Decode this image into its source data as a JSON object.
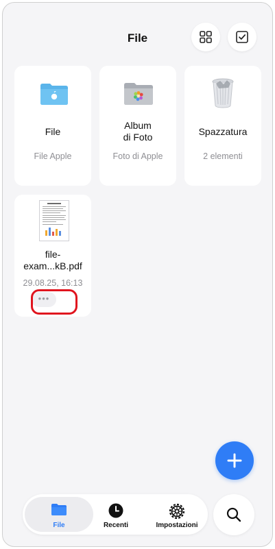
{
  "header": {
    "title": "File"
  },
  "locations": [
    {
      "name": "File",
      "subtitle": "File Apple",
      "icon": "blue-folder-icon"
    },
    {
      "name": "Album\ndi Foto",
      "subtitle": "Foto di Apple",
      "icon": "photos-folder-icon"
    },
    {
      "name": "Spazzatura",
      "subtitle": "2 elementi",
      "icon": "trash-icon"
    }
  ],
  "files": [
    {
      "name": "file-\nexam...kB.pdf",
      "date": "29.08.25, 16:13",
      "more_label": "•••",
      "icon": "pdf-thumbnail-icon"
    }
  ],
  "tabbar": {
    "tabs": [
      {
        "label": "File",
        "icon": "folder-icon",
        "selected": true
      },
      {
        "label": "Recenti",
        "icon": "clock-icon",
        "selected": false
      },
      {
        "label": "Impostazioni",
        "icon": "gear-icon",
        "selected": false
      }
    ]
  },
  "colors": {
    "accent": "#2f7df6",
    "highlight": "#e0141e",
    "background": "#f5f5f7"
  }
}
